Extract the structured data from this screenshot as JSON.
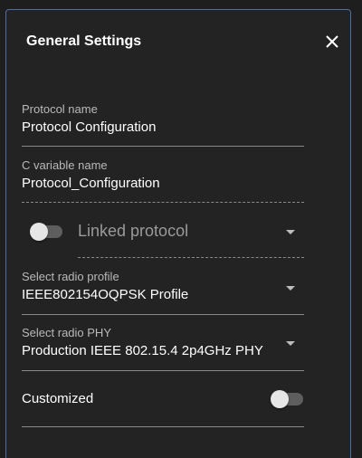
{
  "dialog": {
    "title": "General Settings",
    "close_icon": "close-icon"
  },
  "fields": {
    "protocol_name": {
      "label": "Protocol name",
      "value": "Protocol Configuration"
    },
    "c_variable_name": {
      "label": "C variable name",
      "value": "Protocol_Configuration"
    },
    "linked_protocol": {
      "label": "Linked protocol",
      "enabled": false
    },
    "radio_profile": {
      "label": "Select radio profile",
      "value": "IEEE802154OQPSK Profile"
    },
    "radio_phy": {
      "label": "Select radio PHY",
      "value": "Production IEEE 802.15.4 2p4GHz PHY"
    },
    "customized": {
      "label": "Customized",
      "enabled": false
    }
  },
  "colors": {
    "background": "#232323",
    "border_accent": "#4a6fa5",
    "text_primary": "#ffffff",
    "text_secondary": "#b9b9b9"
  }
}
